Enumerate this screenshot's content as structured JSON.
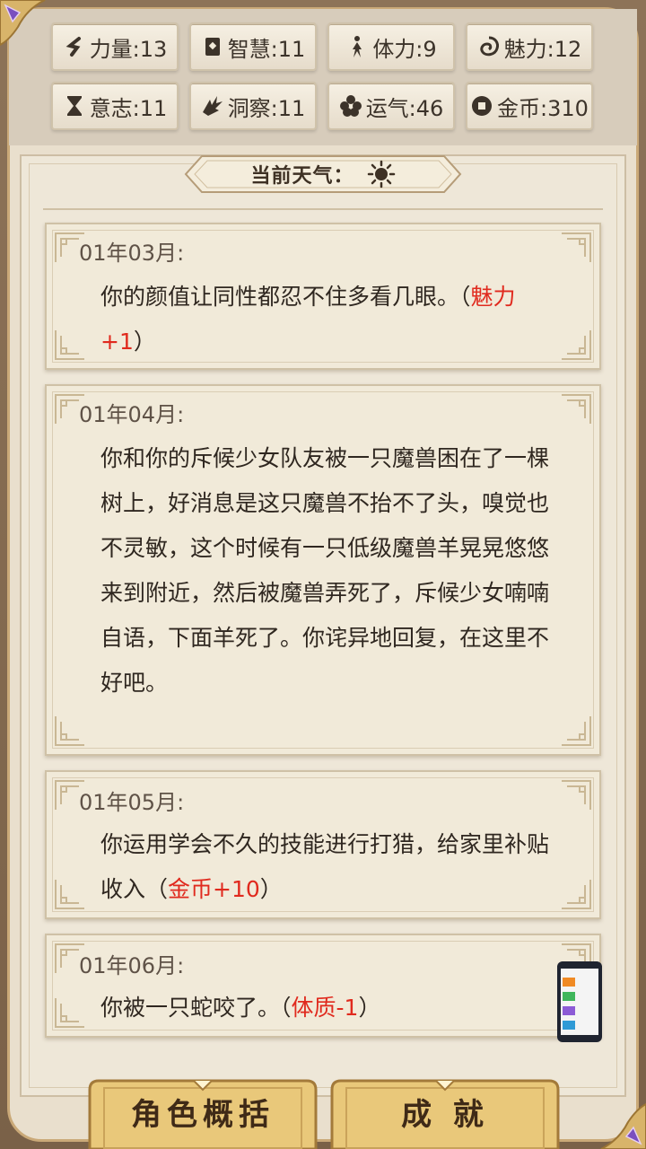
{
  "stats": [
    {
      "icon": "strength-icon",
      "label": "力量:13"
    },
    {
      "icon": "wisdom-book-icon",
      "label": "智慧:11"
    },
    {
      "icon": "stamina-figure-icon",
      "label": "体力:9"
    },
    {
      "icon": "charm-icon",
      "label": "魅力:12"
    },
    {
      "icon": "hourglass-icon",
      "label": "意志:11"
    },
    {
      "icon": "insight-icon",
      "label": "洞察:11"
    },
    {
      "icon": "luck-clover-icon",
      "label": "运气:46"
    },
    {
      "icon": "gold-coin-icon",
      "label": "金币:310"
    }
  ],
  "weather": {
    "label": "当前天气：",
    "icon": "sun-icon"
  },
  "events": [
    {
      "date": "01年03月:",
      "text": "你的颜值让同性都忍不住多看几眼。（",
      "highlight": "魅力+1",
      "suffix": "）"
    },
    {
      "date": "01年04月:",
      "text": "你和你的斥候少女队友被一只魔兽困在了一棵树上，好消息是这只魔兽不抬不了头，嗅觉也不灵敏，这个时候有一只低级魔兽羊晃晃悠悠来到附近，然后被魔兽弄死了，斥候少女喃喃自语，下面羊死了。你诧异地回复，在这里不好吧。",
      "highlight": "",
      "suffix": ""
    },
    {
      "date": "01年05月:",
      "text": "你运用学会不久的技能进行打猎，给家里补贴收入（",
      "highlight": "金币+10",
      "suffix": "）"
    },
    {
      "date": "01年06月:",
      "text": "你被一只蛇咬了。（",
      "highlight": "体质-1",
      "suffix": "）"
    }
  ],
  "buttons": {
    "overview": "角色概括",
    "achievements": "成 就"
  },
  "colors": {
    "highlight": "#e02a1e",
    "text": "#2f2720",
    "date": "#5f5247"
  }
}
